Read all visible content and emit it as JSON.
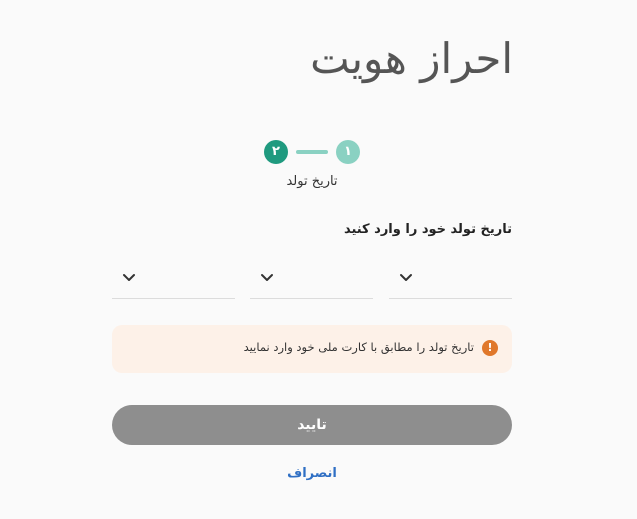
{
  "page": {
    "title": "احراز هویت"
  },
  "stepper": {
    "steps": [
      {
        "number": "۱",
        "state": "completed",
        "color": "#8ad1c2"
      },
      {
        "number": "۲",
        "state": "active",
        "color": "#1f9a7f"
      }
    ],
    "current_label": "تاریخ تولد"
  },
  "form": {
    "instruction": "تاریخ تولد خود را وارد کنید",
    "selects": {
      "day": {
        "value": "",
        "icon": "chevron-down-icon"
      },
      "month": {
        "value": "",
        "icon": "chevron-down-icon"
      },
      "year": {
        "value": "",
        "icon": "chevron-down-icon"
      }
    }
  },
  "alert": {
    "icon": "exclamation-icon",
    "icon_glyph": "!",
    "text": "تاریخ تولد را مطابق با کارت ملی خود وارد نمایید",
    "background": "#fdf1e8",
    "icon_color": "#e0782b"
  },
  "actions": {
    "confirm_label": "تایید",
    "confirm_state": "disabled",
    "cancel_label": "انصراف"
  },
  "colors": {
    "accent": "#1f9a7f",
    "accent_light": "#8ad1c2",
    "link": "#2f6fc4",
    "button_disabled": "#8e8e8e"
  }
}
